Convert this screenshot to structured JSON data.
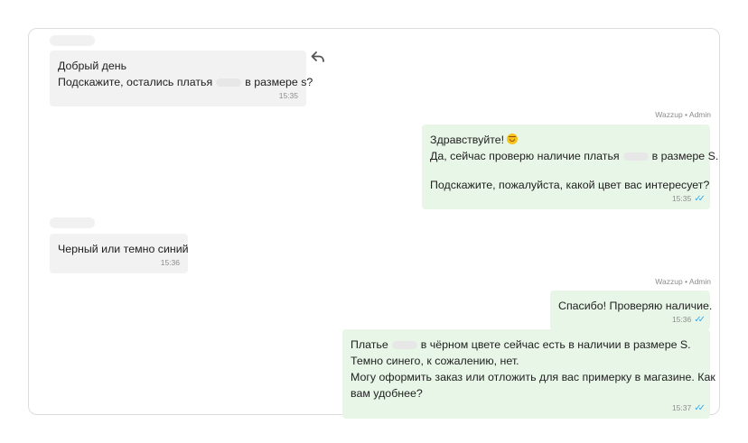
{
  "messages": [
    {
      "lines": [
        "Добрый день",
        "Подскажите, остались платья",
        "в размере s?"
      ],
      "time": "15:35"
    },
    {
      "sender": "Wazzup • Admin",
      "lines": [
        "Здравствуйте!",
        "Да, сейчас проверю наличие платья",
        "в размере S.",
        "Подскажите, пожалуйста, какой цвет вас интересует?"
      ],
      "time": "15:35",
      "status_icon": "double-check-icon"
    },
    {
      "lines": [
        "Черный или темно синий"
      ],
      "time": "15:36"
    },
    {
      "sender": "Wazzup • Admin",
      "lines": [
        "Спасибо! Проверяю наличие."
      ],
      "time": "15:36",
      "status_icon": "double-check-icon"
    },
    {
      "lines": [
        "Платье",
        "в чёрном цвете сейчас есть в наличии в размере S.",
        "Темно синего, к сожалению, нет.",
        "Могу оформить заказ или отложить для вас примерку в магазине. Как",
        "вам удобнее?"
      ],
      "time": "15:37",
      "status_icon": "double-check-icon"
    }
  ],
  "icons": {
    "reply": "reply-icon",
    "emoji": "smiling-face-emoji",
    "check": "double-check-icon"
  },
  "colors": {
    "incoming_bubble": "#f2f2f2",
    "outgoing_bubble": "#e8f6e8",
    "check": "#3aa8e4"
  }
}
